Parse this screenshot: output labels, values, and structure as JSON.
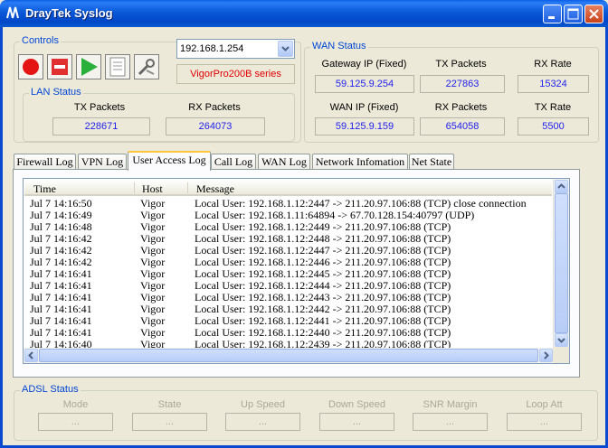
{
  "window": {
    "title": "DrayTek Syslog"
  },
  "controls": {
    "label": "Controls",
    "router_ip": "192.168.1.254",
    "model": "VigorPro200B series",
    "toolbar": [
      "record-icon",
      "stop-icon",
      "play-icon",
      "document-icon",
      "tools-icon"
    ]
  },
  "lan_status": {
    "label": "LAN Status",
    "tx_label": "TX Packets",
    "tx_value": "228671",
    "rx_label": "RX Packets",
    "rx_value": "264073"
  },
  "wan_status": {
    "label": "WAN Status",
    "gateway_label": "Gateway IP (Fixed)",
    "gateway_value": "59.125.9.254",
    "tx_label": "TX Packets",
    "tx_value": "227863",
    "rx_rate_label": "RX Rate",
    "rx_rate_value": "15324",
    "wan_ip_label": "WAN IP (Fixed)",
    "wan_ip_value": "59.125.9.159",
    "rx_label": "RX Packets",
    "rx_value": "654058",
    "tx_rate_label": "TX Rate",
    "tx_rate_value": "5500"
  },
  "tabs": [
    "Firewall Log",
    "VPN Log",
    "User Access Log",
    "Call Log",
    "WAN Log",
    "Network Infomation",
    "Net State"
  ],
  "active_tab": "User Access Log",
  "log": {
    "columns": [
      "Time",
      "Host",
      "Message"
    ],
    "rows": [
      [
        "Jul  7 14:16:50",
        "Vigor",
        "Local User: 192.168.1.12:2447 -> 211.20.97.106:88 (TCP) close connection"
      ],
      [
        "Jul  7 14:16:49",
        "Vigor",
        "Local User: 192.168.1.11:64894 -> 67.70.128.154:40797 (UDP)"
      ],
      [
        "Jul  7 14:16:48",
        "Vigor",
        "Local User: 192.168.1.12:2449 -> 211.20.97.106:88 (TCP)"
      ],
      [
        "Jul  7 14:16:42",
        "Vigor",
        "Local User: 192.168.1.12:2448 -> 211.20.97.106:88 (TCP)"
      ],
      [
        "Jul  7 14:16:42",
        "Vigor",
        "Local User: 192.168.1.12:2447 -> 211.20.97.106:88 (TCP)"
      ],
      [
        "Jul  7 14:16:42",
        "Vigor",
        "Local User: 192.168.1.12:2446 -> 211.20.97.106:88 (TCP)"
      ],
      [
        "Jul  7 14:16:41",
        "Vigor",
        "Local User: 192.168.1.12:2445 -> 211.20.97.106:88 (TCP)"
      ],
      [
        "Jul  7 14:16:41",
        "Vigor",
        "Local User: 192.168.1.12:2444 -> 211.20.97.106:88 (TCP)"
      ],
      [
        "Jul  7 14:16:41",
        "Vigor",
        "Local User: 192.168.1.12:2443 -> 211.20.97.106:88 (TCP)"
      ],
      [
        "Jul  7 14:16:41",
        "Vigor",
        "Local User: 192.168.1.12:2442 -> 211.20.97.106:88 (TCP)"
      ],
      [
        "Jul  7 14:16:41",
        "Vigor",
        "Local User: 192.168.1.12:2441 -> 211.20.97.106:88 (TCP)"
      ],
      [
        "Jul  7 14:16:41",
        "Vigor",
        "Local User: 192.168.1.12:2440 -> 211.20.97.106:88 (TCP)"
      ],
      [
        "Jul  7 14:16:40",
        "Vigor",
        "Local User: 192.168.1.12:2439 -> 211.20.97.106:88 (TCP)"
      ]
    ]
  },
  "adsl_status": {
    "label": "ADSL Status",
    "fields": [
      {
        "label": "Mode",
        "value": "..."
      },
      {
        "label": "State",
        "value": "..."
      },
      {
        "label": "Up Speed",
        "value": "..."
      },
      {
        "label": "Down Speed",
        "value": "..."
      },
      {
        "label": "SNR Margin",
        "value": "..."
      },
      {
        "label": "Loop Att",
        "value": "..."
      }
    ]
  }
}
